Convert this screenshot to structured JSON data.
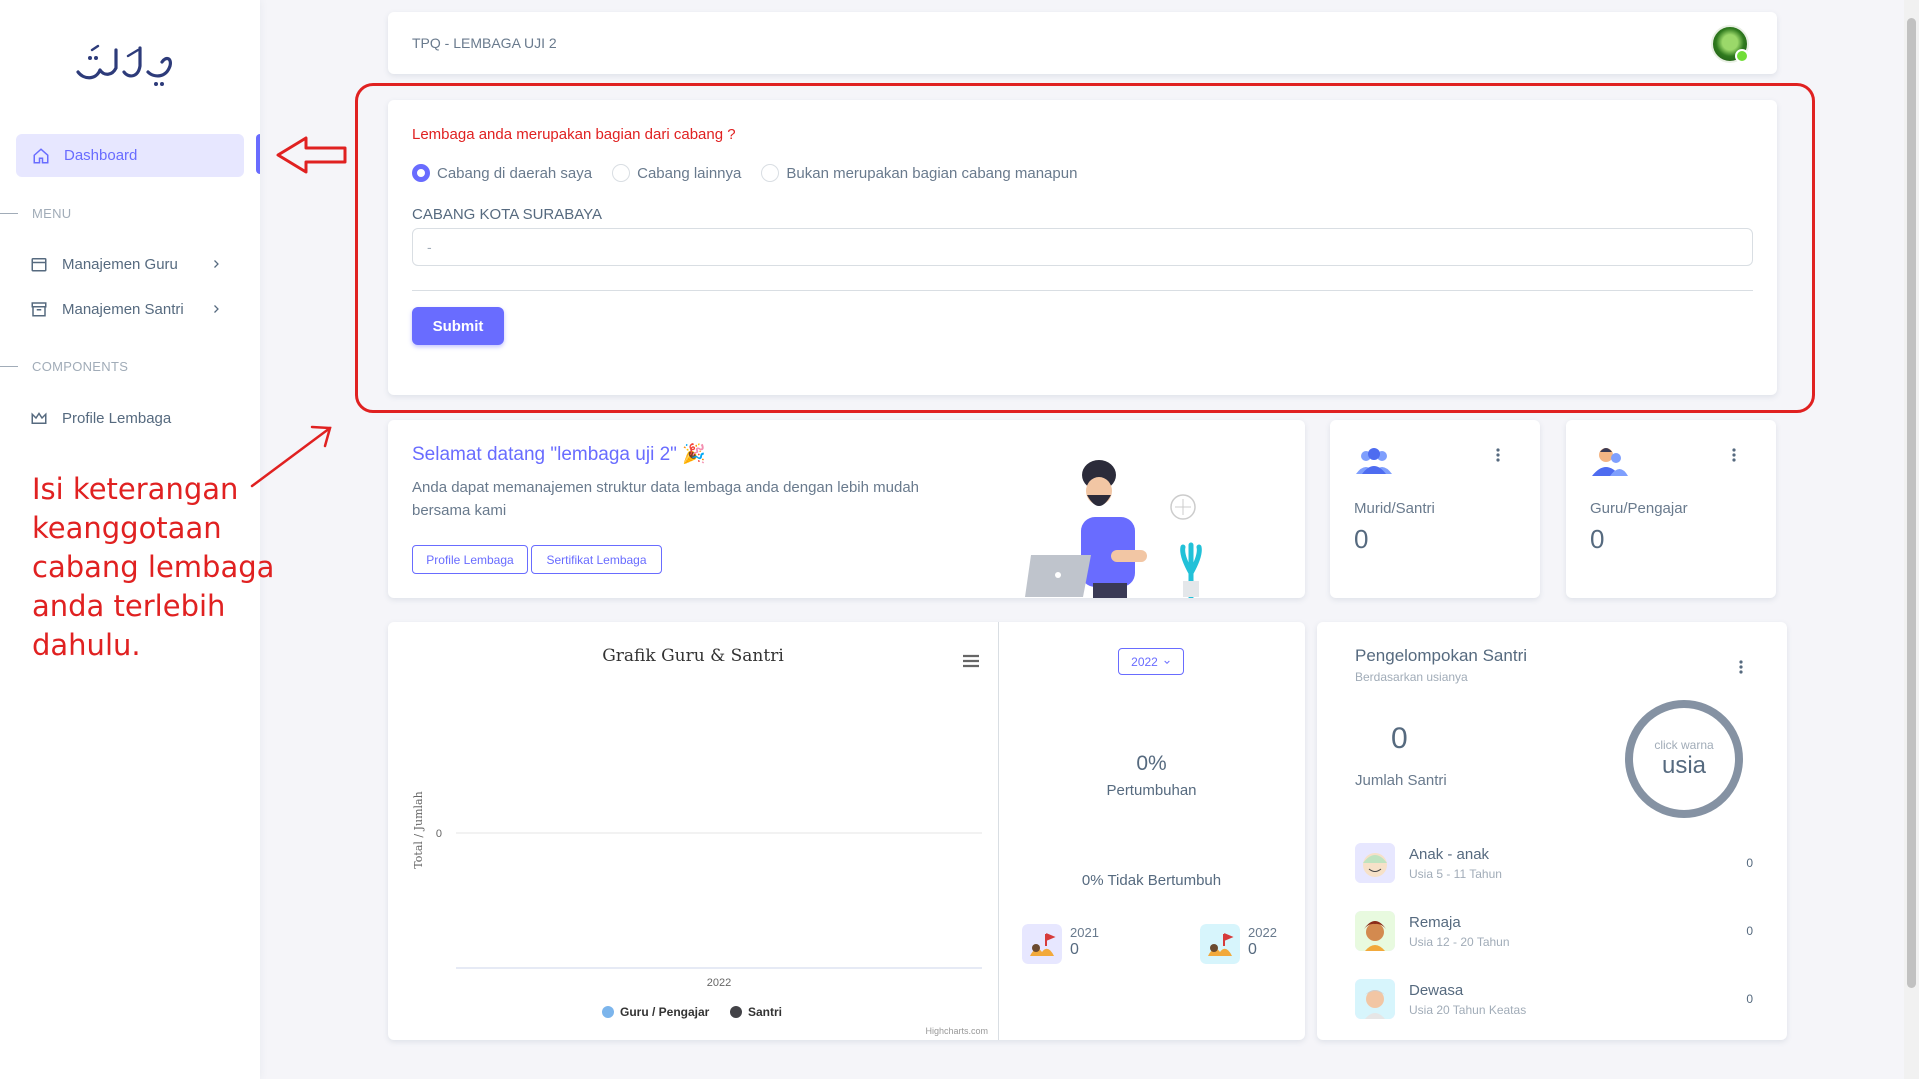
{
  "sidebar": {
    "logo_text": "تلاوتي",
    "active_item": "Dashboard",
    "menu_header": "MENU",
    "items_menu": [
      {
        "label": "Manajemen Guru"
      },
      {
        "label": "Manajemen Santri"
      }
    ],
    "components_header": "COMPONENTS",
    "items_components": [
      {
        "label": "Profile Lembaga"
      }
    ]
  },
  "annotation": {
    "text": "Isi keterangan keanggotaan cabang lembaga anda terlebih dahulu.",
    "color": "#e02121"
  },
  "navbar": {
    "title": "TPQ - LEMBAGA UJI 2"
  },
  "form": {
    "question": "Lembaga anda merupakan bagian dari cabang ?",
    "options": [
      {
        "label": "Cabang di daerah saya",
        "checked": true
      },
      {
        "label": "Cabang lainnya",
        "checked": false
      },
      {
        "label": "Bukan merupakan bagian cabang manapun",
        "checked": false
      }
    ],
    "field_label": "CABANG KOTA SURABAYA",
    "field_value": "-",
    "submit_label": "Submit"
  },
  "welcome": {
    "title": "Selamat datang \"lembaga uji 2\" 🎉",
    "text": "Anda dapat memanajemen struktur data lembaga anda dengan lebih mudah bersama kami",
    "btn_profile": "Profile Lembaga",
    "btn_certificate": "Sertifikat Lembaga"
  },
  "stats": {
    "murid": {
      "label": "Murid/Santri",
      "value": "0"
    },
    "guru": {
      "label": "Guru/Pengajar",
      "value": "0"
    }
  },
  "chart": {
    "title": "Grafik Guru & Santri",
    "credit": "Highcharts.com"
  },
  "chart_data": {
    "type": "line",
    "title": "Grafik Guru & Santri",
    "categories": [
      "2022"
    ],
    "ylabel": "Total / Jumlah",
    "y_ticks": [
      "0"
    ],
    "series": [
      {
        "name": "Guru / Pengajar",
        "values": [
          0
        ],
        "color": "#7cb5ec"
      },
      {
        "name": "Santri",
        "values": [
          0
        ],
        "color": "#434348"
      }
    ],
    "legend_position": "bottom"
  },
  "growth": {
    "year_selected": "2022",
    "percent": "0%",
    "label": "Pertumbuhan",
    "no_growth": "0% Tidak Bertumbuh",
    "years": [
      {
        "year": "2021",
        "value": "0"
      },
      {
        "year": "2022",
        "value": "0"
      }
    ]
  },
  "grouping": {
    "title": "Pengelompokan Santri",
    "subtitle": "Berdasarkan usianya",
    "total": "0",
    "total_label": "Jumlah Santri",
    "donut_small": "click warna",
    "donut_big": "usia",
    "groups": [
      {
        "name": "Anak - anak",
        "age": "Usia 5 - 11 Tahun",
        "value": "0"
      },
      {
        "name": "Remaja",
        "age": "Usia 12 - 20 Tahun",
        "value": "0"
      },
      {
        "name": "Dewasa",
        "age": "Usia 20 Tahun Keatas",
        "value": "0"
      }
    ]
  },
  "colors": {
    "primary": "#696cff",
    "annotation_red": "#e02121"
  }
}
